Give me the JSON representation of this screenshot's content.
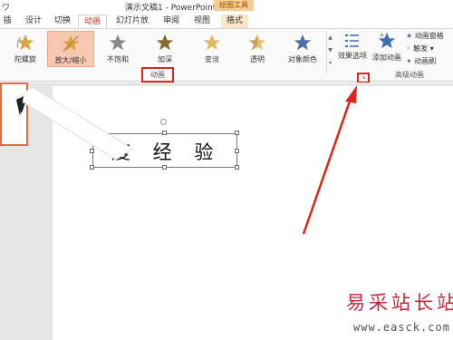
{
  "window": {
    "title": "演示文稿1 - PowerPoint",
    "qat_glyph": "ワ",
    "context_tab_group": "绘图工具"
  },
  "tabs": [
    {
      "label": "插入"
    },
    {
      "label": "设计"
    },
    {
      "label": "切换"
    },
    {
      "label": "动画",
      "active": true
    },
    {
      "label": "幻灯片放映"
    },
    {
      "label": "审阅"
    },
    {
      "label": "视图"
    },
    {
      "label": "格式"
    }
  ],
  "ribbon": {
    "gallery": [
      {
        "label": "陀螺旋",
        "icon": "spin-star-icon",
        "color": "#d9a441"
      },
      {
        "label": "放大/缩小",
        "icon": "grow-shrink-star-icon",
        "color": "#d9a441",
        "selected": true
      },
      {
        "label": "不饱和",
        "icon": "desaturate-star-icon",
        "color": "#888888"
      },
      {
        "label": "加深",
        "icon": "darken-star-icon",
        "color": "#8a6a2a"
      },
      {
        "label": "变淡",
        "icon": "lighten-star-icon",
        "color": "#e0b860"
      },
      {
        "label": "透明",
        "icon": "transparency-star-icon",
        "color": "#e4c070"
      },
      {
        "label": "对象颜色",
        "icon": "object-color-star-icon",
        "color": "#4a6fa5"
      }
    ],
    "effect_options": "效果选项",
    "add_animation": "添加动画",
    "animation_pane": "动画窗格",
    "trigger": "触发",
    "animation_painter": "动画刷",
    "group_animation": "动画",
    "group_advanced": "高级动画",
    "launcher_glyph": "↘"
  },
  "slide": {
    "textbox_text": "度 经 验"
  },
  "watermark": {
    "main": "易采站长站",
    "url": "www.easck.com"
  },
  "colors": {
    "accent": "#c0392b",
    "annotation_red": "#e0251c",
    "selected_bg": "#f8c9b0"
  }
}
